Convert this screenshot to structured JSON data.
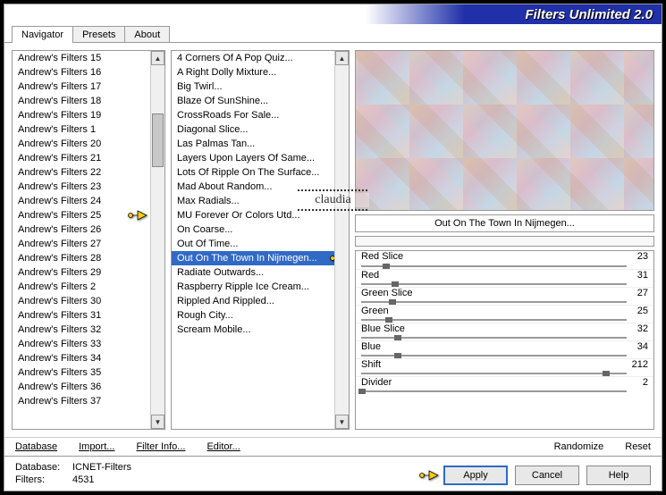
{
  "title": "Filters Unlimited 2.0",
  "tabs": [
    "Navigator",
    "Presets",
    "About"
  ],
  "active_tab": 0,
  "categories": [
    "Andrew's Filters 15",
    "Andrew's Filters 16",
    "Andrew's Filters 17",
    "Andrew's Filters 18",
    "Andrew's Filters 19",
    "Andrew's Filters 1",
    "Andrew's Filters 20",
    "Andrew's Filters 21",
    "Andrew's Filters 22",
    "Andrew's Filters 23",
    "Andrew's Filters 24",
    "Andrew's Filters 25",
    "Andrew's Filters 26",
    "Andrew's Filters 27",
    "Andrew's Filters 28",
    "Andrew's Filters 29",
    "Andrew's Filters 2",
    "Andrew's Filters 30",
    "Andrew's Filters 31",
    "Andrew's Filters 32",
    "Andrew's Filters 33",
    "Andrew's Filters 34",
    "Andrew's Filters 35",
    "Andrew's Filters 36",
    "Andrew's Filters 37"
  ],
  "category_pointer_index": 11,
  "filters": [
    "4 Corners Of A Pop Quiz...",
    "A Right Dolly Mixture...",
    "Big Twirl...",
    "Blaze Of SunShine...",
    "CrossRoads For Sale...",
    "Diagonal Slice...",
    "Las Palmas Tan...",
    "Layers Upon Layers Of Same...",
    "Lots Of Ripple On The Surface...",
    "Mad About Random...",
    "Max Radials...",
    "MU Forever Or Colors Utd...",
    "On Coarse...",
    "Out Of Time...",
    "Out On The Town In Nijmegen...",
    "Radiate Outwards...",
    "Raspberry Ripple Ice Cream...",
    "Rippled And Rippled...",
    "Rough City...",
    "Scream Mobile..."
  ],
  "filter_selected_index": 14,
  "current_filter": "Out On The Town In Nijmegen...",
  "sliders": [
    {
      "label": "Red Slice",
      "value": 23,
      "pos": 9
    },
    {
      "label": "Red",
      "value": 31,
      "pos": 12
    },
    {
      "label": "Green Slice",
      "value": 27,
      "pos": 11
    },
    {
      "label": "Green",
      "value": 25,
      "pos": 10
    },
    {
      "label": "Blue Slice",
      "value": 32,
      "pos": 13
    },
    {
      "label": "Blue",
      "value": 34,
      "pos": 13
    },
    {
      "label": "Shift",
      "value": 212,
      "pos": 83
    },
    {
      "label": "Divider",
      "value": 2,
      "pos": 1
    }
  ],
  "toolbar": {
    "database": "Database",
    "import": "Import...",
    "filterinfo": "Filter Info...",
    "editor": "Editor...",
    "randomize": "Randomize",
    "reset": "Reset"
  },
  "footer": {
    "db_label": "Database:",
    "db_value": "ICNET-Filters",
    "filters_label": "Filters:",
    "filters_value": "4531"
  },
  "buttons": {
    "apply": "Apply",
    "cancel": "Cancel",
    "help": "Help"
  },
  "watermark": "claudia"
}
